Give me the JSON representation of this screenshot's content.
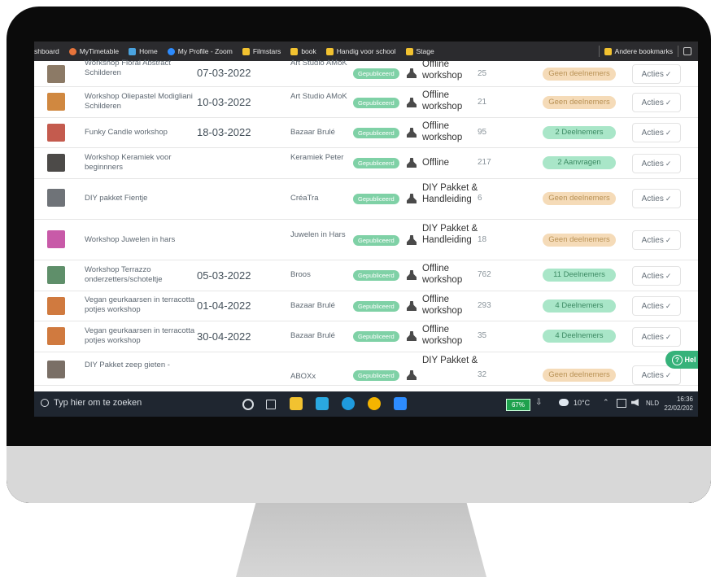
{
  "bookmarks": {
    "items": [
      {
        "label": "shboard",
        "icon": "dashboard-icon"
      },
      {
        "label": "MyTimetable",
        "icon": "timetable-icon"
      },
      {
        "label": "Home",
        "icon": "home-icon"
      },
      {
        "label": "My Profile - Zoom",
        "icon": "zoom-icon"
      },
      {
        "label": "Filmstars",
        "icon": "folder-icon"
      },
      {
        "label": "book",
        "icon": "folder-icon"
      },
      {
        "label": "Handig voor school",
        "icon": "folder-icon"
      },
      {
        "label": "Stage",
        "icon": "folder-icon"
      }
    ],
    "other_label": "Andere bookmarks"
  },
  "rows": [
    {
      "name": "Workshop Floral Abstract Schilderen",
      "date": "07-03-2022",
      "organizer": "Art Studio AMoK",
      "status": "Gepubliceerd",
      "type": "Offline workshop",
      "count": "25",
      "participants": "Geen deelnemers",
      "participants_kind": "none",
      "action": "Acties",
      "thumb_color": "#8c7a66"
    },
    {
      "name": "Workshop Oliepastel Modigliani Schilderen",
      "date": "10-03-2022",
      "organizer": "Art Studio AMoK",
      "status": "Gepubliceerd",
      "type": "Offline workshop",
      "count": "21",
      "participants": "Geen deelnemers",
      "participants_kind": "none",
      "action": "Acties",
      "thumb_color": "#d08840"
    },
    {
      "name": "Funky Candle workshop",
      "date": "18-03-2022",
      "organizer": "Bazaar Brulé",
      "status": "Gepubliceerd",
      "type": "Offline workshop",
      "count": "95",
      "participants": "2 Deelnemers",
      "participants_kind": "some",
      "action": "Acties",
      "thumb_color": "#c45b4e"
    },
    {
      "name": "Workshop Keramiek voor beginnners",
      "date": "",
      "organizer": "Keramiek Peter",
      "status": "Gepubliceerd",
      "type": "Offline",
      "count": "217",
      "participants": "2 Aanvragen",
      "participants_kind": "some",
      "action": "Acties",
      "thumb_color": "#4c4a48"
    },
    {
      "name": "DIY pakket Fientje",
      "date": "",
      "organizer": "CréaTra",
      "status": "Gepubliceerd",
      "type": "DIY Pakket & Handleiding",
      "count": "6",
      "participants": "Geen deelnemers",
      "participants_kind": "none",
      "action": "Acties",
      "thumb_color": "#6f7378"
    },
    {
      "name": "Workshop Juwelen in hars",
      "date": "",
      "organizer": "Juwelen in Hars",
      "status": "Gepubliceerd",
      "type": "DIY Pakket & Handleiding",
      "count": "18",
      "participants": "Geen deelnemers",
      "participants_kind": "none",
      "action": "Acties",
      "thumb_color": "#c85aa8"
    },
    {
      "name": "Workshop Terrazzo onderzetters/schoteltje",
      "date": "05-03-2022",
      "organizer": "Broos",
      "status": "Gepubliceerd",
      "type": "Offline workshop",
      "count": "762",
      "participants": "11 Deelnemers",
      "participants_kind": "some",
      "action": "Acties",
      "thumb_color": "#5f8f6a"
    },
    {
      "name": "Vegan geurkaarsen in terracotta potjes workshop",
      "date": "01-04-2022",
      "organizer": "Bazaar Brulé",
      "status": "Gepubliceerd",
      "type": "Offline workshop",
      "count": "293",
      "participants": "4 Deelnemers",
      "participants_kind": "some",
      "action": "Acties",
      "thumb_color": "#d07a3f"
    },
    {
      "name": "Vegan geurkaarsen in terracotta potjes workshop",
      "date": "30-04-2022",
      "organizer": "Bazaar Brulé",
      "status": "Gepubliceerd",
      "type": "Offline workshop",
      "count": "35",
      "participants": "4 Deelnemers",
      "participants_kind": "some",
      "action": "Acties",
      "thumb_color": "#d07a3f"
    },
    {
      "name": "DIY Pakket zeep gieten -",
      "date": "",
      "organizer": "ABOXx",
      "status": "Gepubliceerd",
      "type": "DIY Pakket &",
      "count": "32",
      "participants": "Geen deelnemers",
      "participants_kind": "none",
      "action": "Acties",
      "thumb_color": "#7a6f66"
    }
  ],
  "help_label": "Hel",
  "taskbar": {
    "search_placeholder": "Typ hier om te zoeken",
    "battery": "67%",
    "weather": "10°C",
    "language": "NLD",
    "time": "16:36",
    "date": "22/02/202"
  }
}
